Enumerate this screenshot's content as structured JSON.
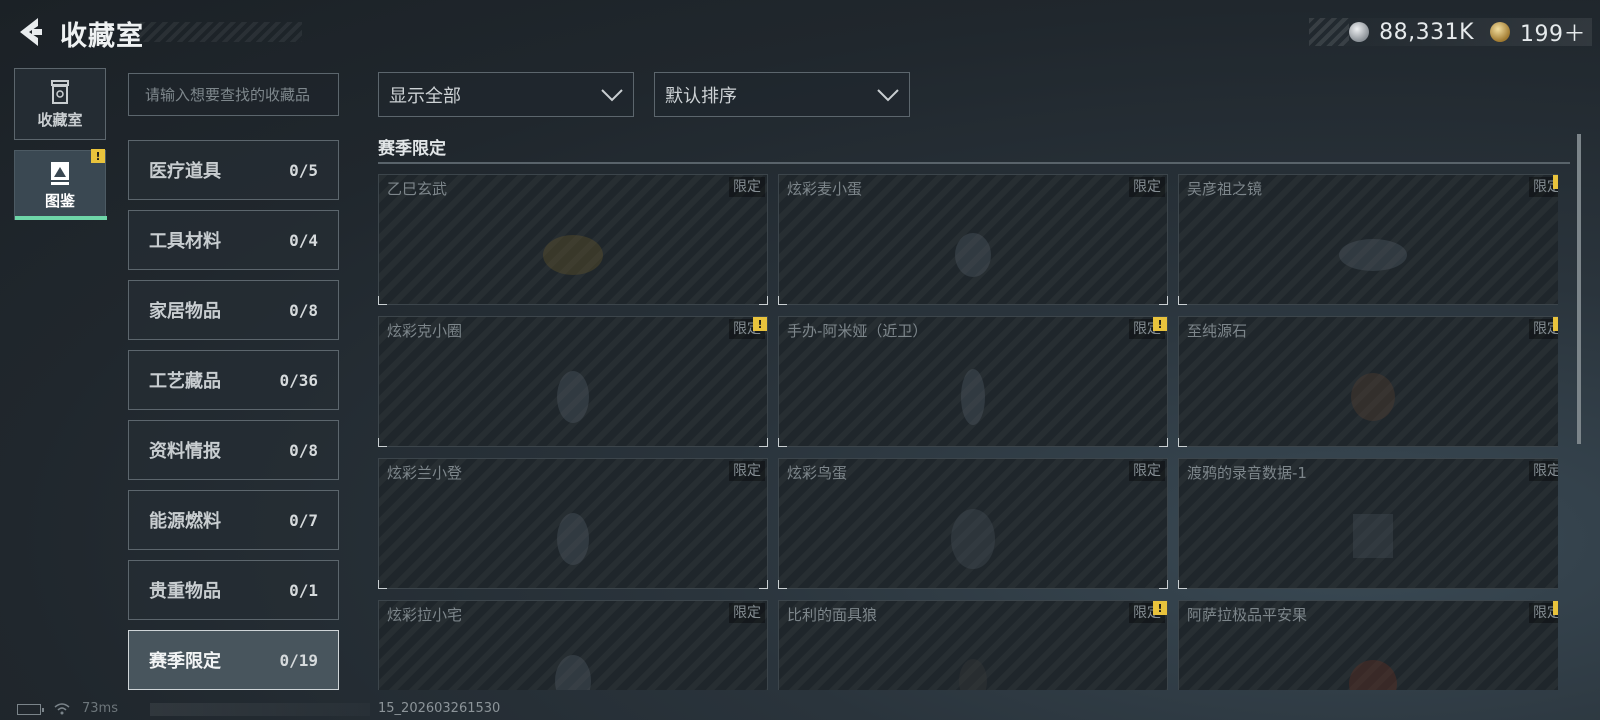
{
  "header": {
    "title": "收藏室",
    "currencies": [
      {
        "icon": "silver-coin-icon",
        "value": "88,331K"
      },
      {
        "icon": "gold-coin-icon",
        "value": "199＋"
      }
    ]
  },
  "nav": [
    {
      "label": "收藏室",
      "icon": "trash-bin-icon",
      "active": false
    },
    {
      "label": "图鉴",
      "icon": "catalog-book-icon",
      "active": true,
      "alert": "!"
    }
  ],
  "search": {
    "placeholder": "请输入想要查找的收藏品"
  },
  "categories": [
    {
      "label": "医疗道具",
      "count": "0/5"
    },
    {
      "label": "工具材料",
      "count": "0/4"
    },
    {
      "label": "家居物品",
      "count": "0/8"
    },
    {
      "label": "工艺藏品",
      "count": "0/36"
    },
    {
      "label": "资料情报",
      "count": "0/8"
    },
    {
      "label": "能源燃料",
      "count": "0/7"
    },
    {
      "label": "贵重物品",
      "count": "0/1"
    },
    {
      "label": "赛季限定",
      "count": "0/19",
      "active": true
    }
  ],
  "filters": {
    "show": "显示全部",
    "sort": "默认排序"
  },
  "section": {
    "title": "赛季限定"
  },
  "items": [
    {
      "name": "乙巳玄武",
      "tag": "限定",
      "alert": false
    },
    {
      "name": "炫彩麦小蛋",
      "tag": "限定",
      "alert": false
    },
    {
      "name": "吴彦祖之镜",
      "tag": "限定",
      "alert": true
    },
    {
      "name": "炫彩克小圈",
      "tag": "限定",
      "alert": true
    },
    {
      "name": "手办-阿米娅（近卫）",
      "tag": "限定",
      "alert": true
    },
    {
      "name": "至纯源石",
      "tag": "限定",
      "alert": true
    },
    {
      "name": "炫彩兰小登",
      "tag": "限定",
      "alert": false
    },
    {
      "name": "炫彩鸟蛋",
      "tag": "限定",
      "alert": false
    },
    {
      "name": "渡鸦的录音数据-1",
      "tag": "限定",
      "alert": false
    },
    {
      "name": "炫彩拉小宅",
      "tag": "限定",
      "alert": false
    },
    {
      "name": "比利的面具狼",
      "tag": "限定",
      "alert": true
    },
    {
      "name": "阿萨拉极品平安果",
      "tag": "限定",
      "alert": true
    }
  ],
  "status": {
    "ping": "73ms",
    "build": "15_202603261530"
  },
  "colors": {
    "accent": "#6ed6a8",
    "alert": "#e9c33c"
  }
}
